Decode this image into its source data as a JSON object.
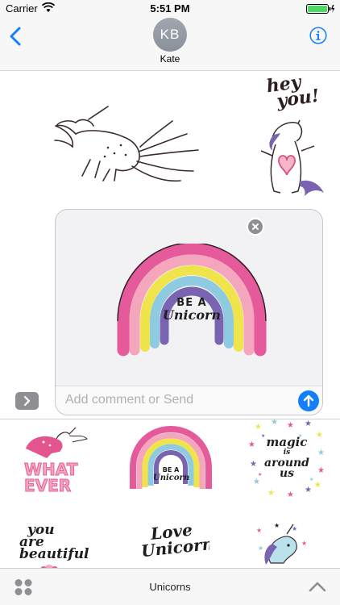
{
  "status_bar": {
    "carrier": "Carrier",
    "time": "5:51 PM"
  },
  "header": {
    "avatar_initials": "KB",
    "contact_name": "Kate"
  },
  "conversation": {
    "sticker_1": "unicorn-running",
    "sticker_2_text": [
      "hey",
      "you!"
    ],
    "selected_sticker_text": [
      "BE A",
      "Unicorn"
    ]
  },
  "compose": {
    "placeholder": "Add comment or Send"
  },
  "drawer": {
    "stickers": [
      {
        "id": "what-ever",
        "text": [
          "WHAT",
          "EVER"
        ]
      },
      {
        "id": "be-a-unicorn",
        "text": [
          "BE A",
          "Unicorn"
        ]
      },
      {
        "id": "magic-is-around-us",
        "text": [
          "magic",
          "is",
          "around",
          "us"
        ]
      },
      {
        "id": "you-are-beautiful",
        "text": [
          "you",
          "are",
          "beautiful"
        ]
      },
      {
        "id": "love-unicorns",
        "text": [
          "Love",
          "Unicorns"
        ]
      },
      {
        "id": "unicorn-head",
        "text": []
      }
    ]
  },
  "bottom_bar": {
    "title": "Unicorns"
  },
  "colors": {
    "accent": "#147efb",
    "pink": "#e45a9a",
    "purple": "#7a63b1",
    "yellow": "#f0e44c",
    "blue": "#8fcbe0"
  }
}
